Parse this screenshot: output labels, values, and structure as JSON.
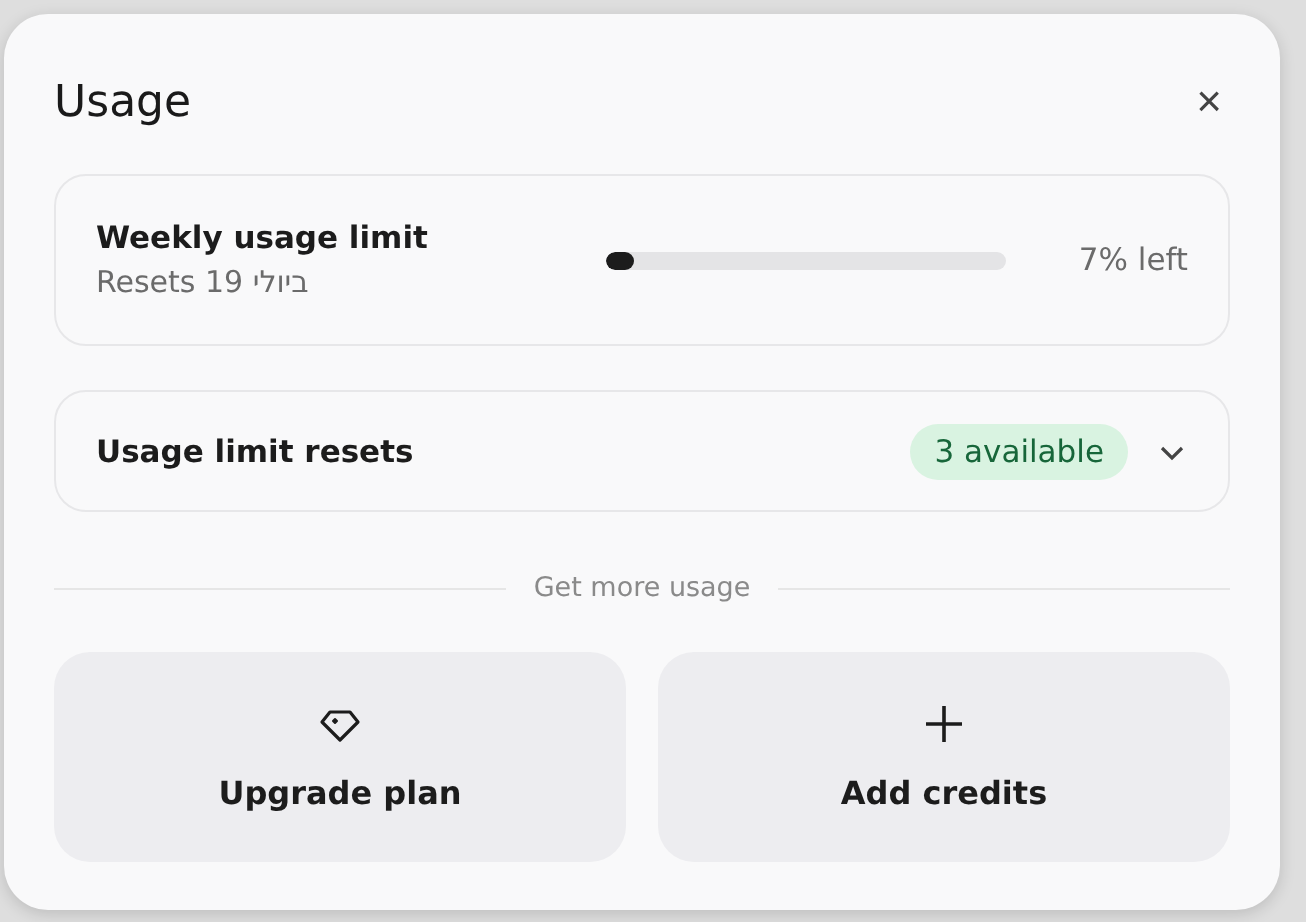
{
  "dialog": {
    "title": "Usage",
    "close": "×"
  },
  "weekly_limit": {
    "title": "Weekly usage limit",
    "subtitle": "Resets 19 ביולי",
    "level": 0.07,
    "reading": "7% left"
  },
  "limit_resets": {
    "title": "Usage limit resets",
    "badge": "3 available",
    "expanded": false
  },
  "divider_label": "Get more usage",
  "actions": [
    {
      "kind": "upgrade",
      "label": "Upgrade plan"
    },
    {
      "kind": "add",
      "label": "Add credits"
    }
  ]
}
